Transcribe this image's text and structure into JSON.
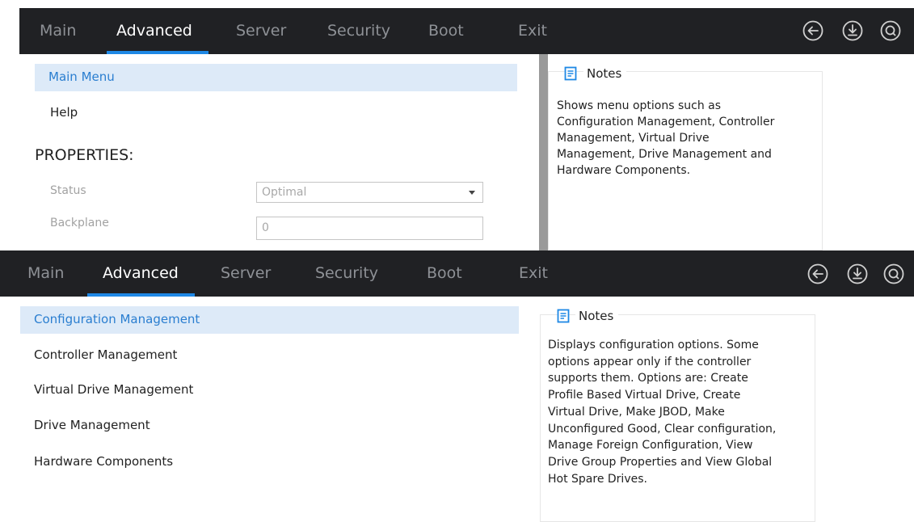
{
  "colors": {
    "navbar_bg": "#202124",
    "nav_active": "#ffffff",
    "nav_inactive": "#8e9196",
    "accent": "#1e88e5",
    "menu_selected_bg": "#ddeaf8",
    "menu_selected_text": "#2a7ed0",
    "notes_icon": "#1e88e5"
  },
  "nav": {
    "tabs": [
      "Main",
      "Advanced",
      "Server",
      "Security",
      "Boot",
      "Exit"
    ],
    "active_tab": "Advanced",
    "icons": [
      "back-arrow-icon",
      "download-icon",
      "search-icon"
    ]
  },
  "top_screen": {
    "menu_selected": "Main Menu",
    "help_item": "Help",
    "properties_heading": "PROPERTIES:",
    "status": {
      "label": "Status",
      "value": "Optimal"
    },
    "backplane": {
      "label": "Backplane",
      "value": "0"
    },
    "notes": {
      "title": "Notes",
      "lines": [
        "Shows menu options such as",
        "Configuration Management, Controller",
        "Management, Virtual Drive",
        "Management, Drive Management and",
        "Hardware Components."
      ]
    }
  },
  "bottom_screen": {
    "menu_items": [
      "Configuration Management",
      "Controller Management",
      "Virtual Drive Management",
      "Drive Management",
      "Hardware Components"
    ],
    "selected_item": "Configuration Management",
    "notes": {
      "title": "Notes",
      "lines": [
        "Displays configuration options. Some",
        "options appear only if the controller",
        "supports them. Options are: Create",
        "Profile Based Virtual Drive, Create",
        "Virtual Drive, Make JBOD, Make",
        "Unconfigured Good, Clear configuration,",
        "Manage Foreign Configuration, View",
        "Drive Group Properties and View Global",
        "Hot Spare Drives."
      ]
    }
  }
}
